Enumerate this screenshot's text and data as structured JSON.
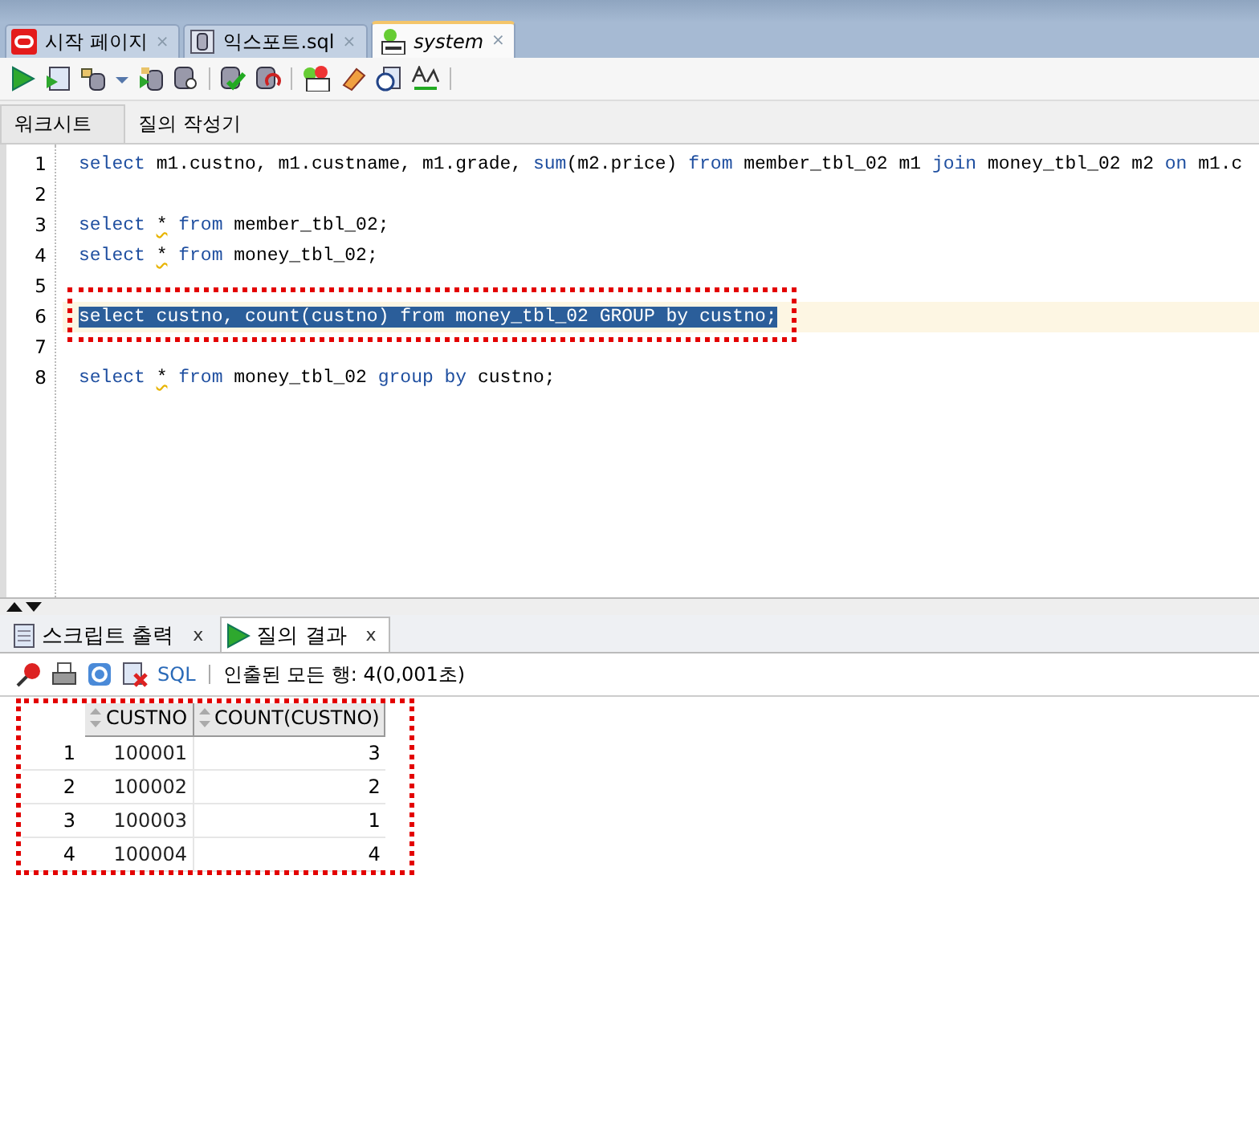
{
  "doc_tabs": [
    {
      "label": "시작 페이지",
      "close": "×",
      "selected": false,
      "kind": "start"
    },
    {
      "label": "익스포트.sql",
      "close": "×",
      "selected": false,
      "kind": "file"
    },
    {
      "label": "system",
      "close": "×",
      "selected": true,
      "kind": "sql"
    }
  ],
  "sub_tabs": [
    {
      "label": "워크시트",
      "selected": true
    },
    {
      "label": "질의 작성기",
      "selected": false
    }
  ],
  "editor": {
    "lines": [
      {
        "number": "1",
        "selected": false,
        "tokens": [
          {
            "text": "select",
            "kind": "keyword"
          },
          {
            "text": " m1.custno, m1.custname, m1.grade, ",
            "kind": "plain"
          },
          {
            "text": "sum",
            "kind": "keyword"
          },
          {
            "text": "(m2.price) ",
            "kind": "plain"
          },
          {
            "text": "from",
            "kind": "keyword"
          },
          {
            "text": " member_tbl_02 m1 ",
            "kind": "plain"
          },
          {
            "text": "join",
            "kind": "keyword"
          },
          {
            "text": " money_tbl_02 m2 ",
            "kind": "plain"
          },
          {
            "text": "on",
            "kind": "keyword"
          },
          {
            "text": " m1.c",
            "kind": "plain"
          }
        ]
      },
      {
        "number": "2",
        "selected": false
      },
      {
        "number": "3",
        "selected": false,
        "tokens": [
          {
            "text": "select ",
            "kind": "keyword"
          },
          {
            "text": "*",
            "kind": "warn"
          },
          {
            "text": " from",
            "kind": "keyword"
          },
          {
            "text": " member_tbl_02;",
            "kind": "plain"
          }
        ]
      },
      {
        "number": "4",
        "selected": false,
        "tokens": [
          {
            "text": "select ",
            "kind": "keyword"
          },
          {
            "text": "*",
            "kind": "warn"
          },
          {
            "text": " from",
            "kind": "keyword"
          },
          {
            "text": " money_tbl_02;",
            "kind": "plain"
          }
        ]
      },
      {
        "number": "5",
        "selected": false
      },
      {
        "number": "6",
        "selected": true,
        "tokens": [
          {
            "text": "select custno, count(custno) from money_tbl_02 GROUP by custno;",
            "kind": "plain"
          }
        ]
      },
      {
        "number": "7",
        "selected": false
      },
      {
        "number": "8",
        "selected": false,
        "tokens": [
          {
            "text": "select ",
            "kind": "keyword"
          },
          {
            "text": "*",
            "kind": "warn"
          },
          {
            "text": " from",
            "kind": "keyword"
          },
          {
            "text": " money_tbl_02 ",
            "kind": "plain"
          },
          {
            "text": "group by",
            "kind": "keyword"
          },
          {
            "text": " custno;",
            "kind": "plain"
          }
        ]
      }
    ]
  },
  "result_tabs": [
    {
      "label": "스크립트 출력",
      "close": "x",
      "selected": false,
      "kind": "script"
    },
    {
      "label": "질의 결과",
      "close": "x",
      "selected": true,
      "kind": "run"
    }
  ],
  "result_toolbar": {
    "sql_link": "SQL",
    "status": "인출된 모든 행: 4(0,001초)"
  },
  "table": {
    "columns": [
      "CUSTNO",
      "COUNT(CUSTNO)"
    ],
    "rows": [
      {
        "number": "1",
        "cells": [
          "100001",
          "3"
        ]
      },
      {
        "number": "2",
        "cells": [
          "100002",
          "2"
        ]
      },
      {
        "number": "3",
        "cells": [
          "100003",
          "1"
        ]
      },
      {
        "number": "4",
        "cells": [
          "100004",
          "4"
        ]
      }
    ]
  }
}
